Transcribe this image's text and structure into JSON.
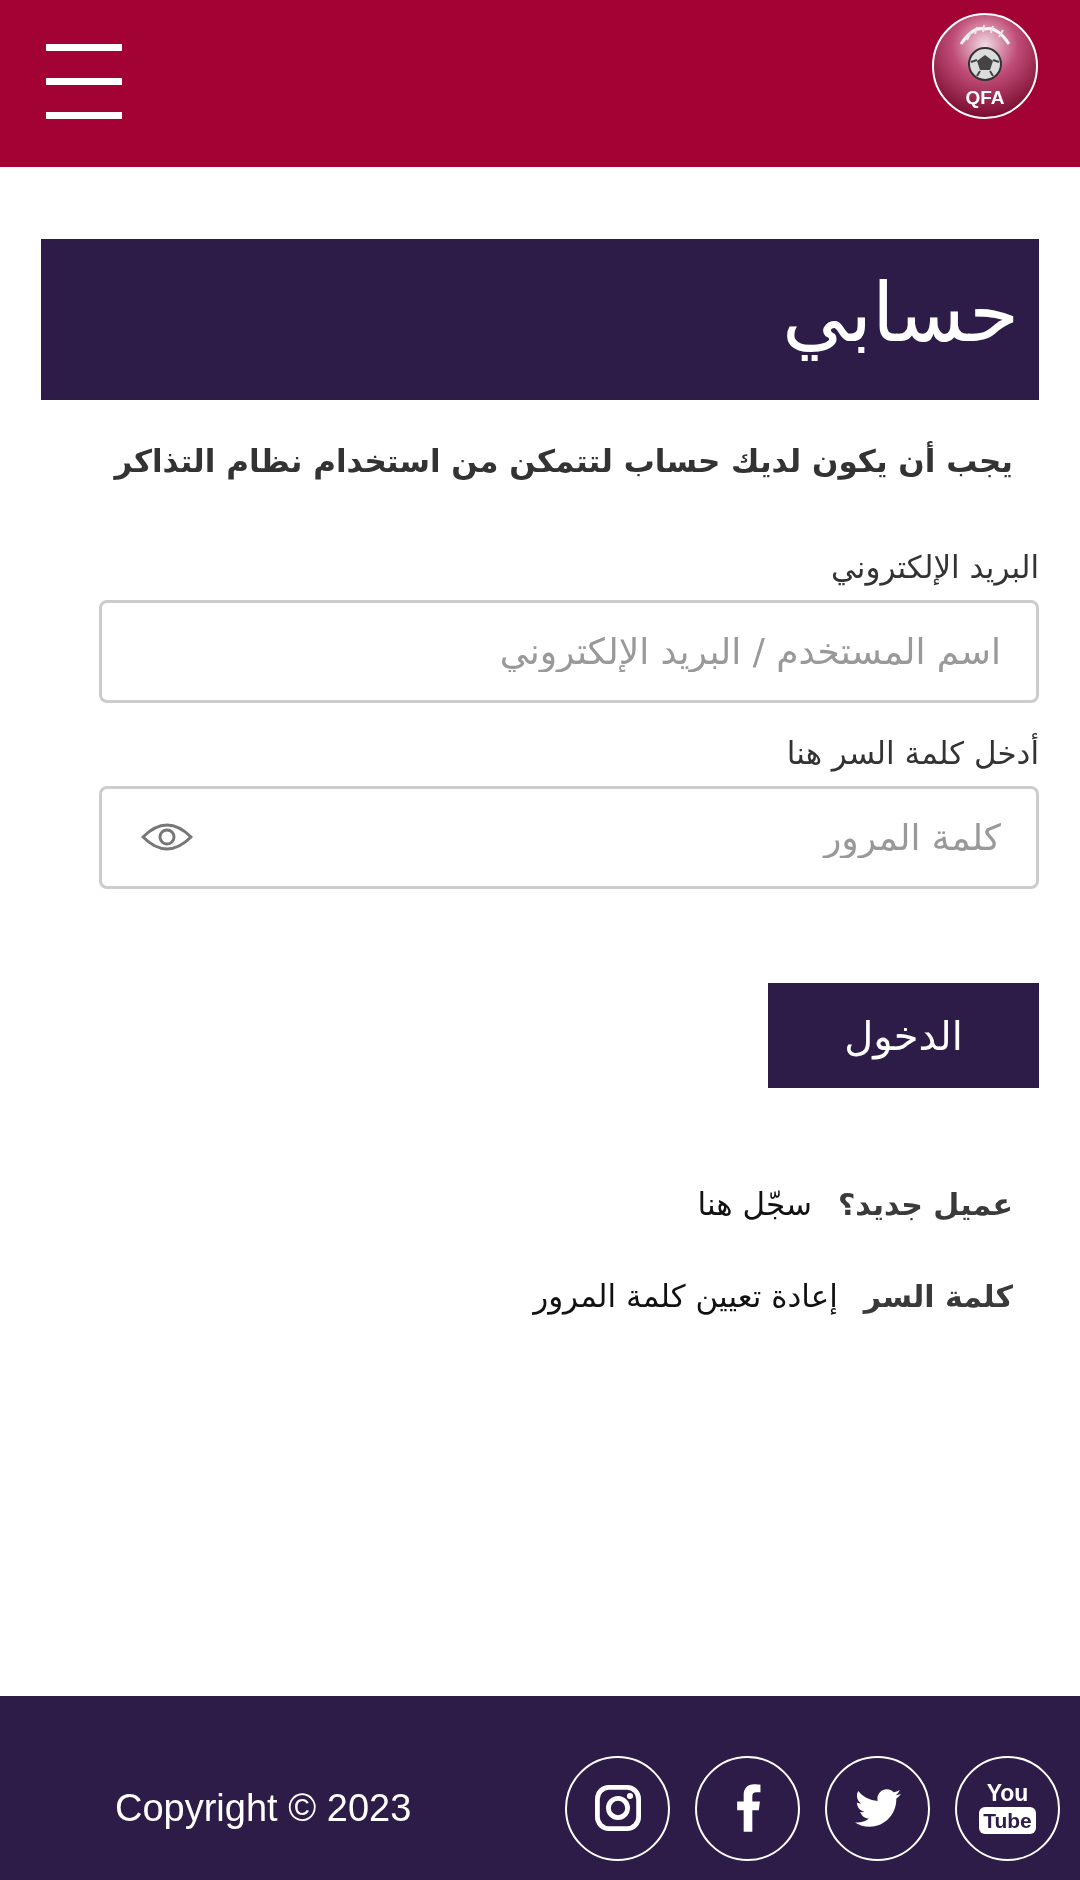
{
  "header": {
    "logo_text": "QFA"
  },
  "title": "حسابي",
  "intro": "يجب أن يكون لديك حساب لتتمكن من استخدام نظام التذاكر",
  "form": {
    "fields": [
      {
        "kind": "email",
        "label": "البريد الإلكتروني",
        "placeholder": "اسم المستخدم / البريد الإلكتروني"
      },
      {
        "kind": "password",
        "label": "أدخل كلمة السر هنا",
        "placeholder": "كلمة المرور"
      }
    ],
    "submit": "الدخول"
  },
  "links": [
    {
      "label": "عميل جديد؟",
      "link": "سجّل هنا"
    },
    {
      "label": "كلمة السر",
      "link": "إعادة تعيين كلمة المرور"
    }
  ],
  "footer": {
    "copyright": "Copyright © 2023",
    "social": [
      {
        "kind": "instagram"
      },
      {
        "kind": "facebook"
      },
      {
        "kind": "twitter"
      },
      {
        "kind": "youtube",
        "text": [
          "You",
          "Tube"
        ]
      }
    ]
  }
}
